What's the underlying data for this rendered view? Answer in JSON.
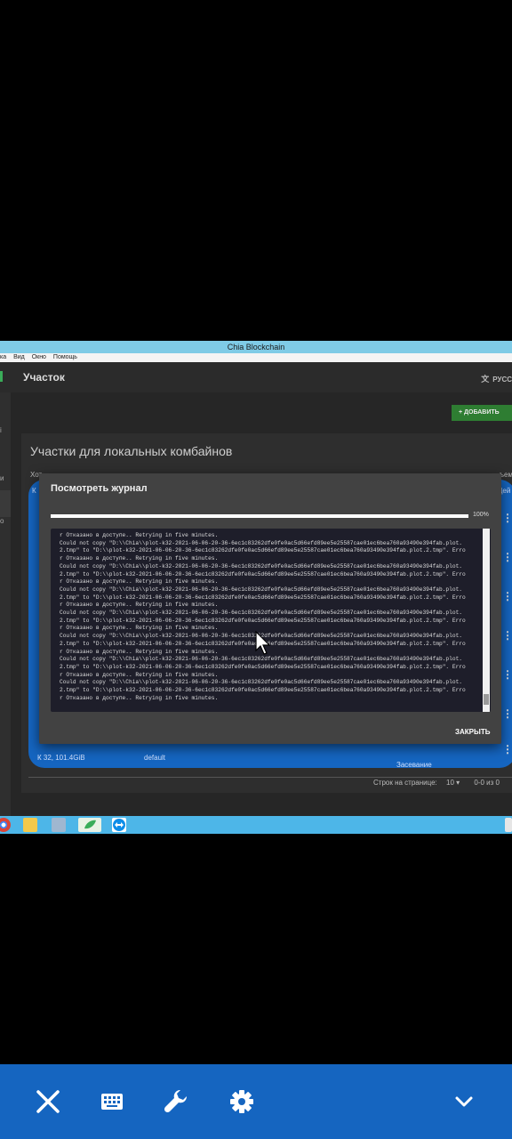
{
  "window": {
    "title": "Chia Blockchain"
  },
  "menu": [
    "ка",
    "Вид",
    "Окно",
    "Помощь"
  ],
  "app": {
    "header_title": "Участок",
    "language": "РУСС",
    "add_button": "+ ДОБАВИТЬ",
    "panel_title": "Участки для локальных комбайнов",
    "left_fragments": [
      "Хот",
      "К"
    ],
    "right_fragments": [
      "ъем",
      "Дей"
    ],
    "bottom_row": {
      "size": "К 32, 101.4GiB",
      "pool": "default",
      "status": "Засевание"
    },
    "pagination": {
      "rows_label": "Строк на странице:",
      "rows_value": "10",
      "range": "0-0 из 0"
    }
  },
  "dialog": {
    "title": "Посмотреть журнал",
    "progress_percent": 100,
    "progress_label": "100%",
    "log_lines": [
      "r Отказано в доступе.. Retrying in five minutes.",
      "Could not copy \"D:\\\\Chia\\\\plot-k32-2021-06-06-20-36-6ec1c83262dfe0fe0ac5d66efd89ee5e25587cae01ec6bea760a93490e394fab.plot.",
      "2.tmp\" to \"D:\\\\plot-k32-2021-06-06-20-36-6ec1c83262dfe0fe0ac5d66efd89ee5e25587cae01ec6bea760a93490e394fab.plot.2.tmp\". Erro",
      "r Отказано в доступе.. Retrying in five minutes.",
      "Could not copy \"D:\\\\Chia\\\\plot-k32-2021-06-06-20-36-6ec1c83262dfe0fe0ac5d66efd89ee5e25587cae01ec6bea760a93490e394fab.plot.",
      "2.tmp\" to \"D:\\\\plot-k32-2021-06-06-20-36-6ec1c83262dfe0fe0ac5d66efd89ee5e25587cae01ec6bea760a93490e394fab.plot.2.tmp\". Erro",
      "r Отказано в доступе.. Retrying in five minutes.",
      "Could not copy \"D:\\\\Chia\\\\plot-k32-2021-06-06-20-36-6ec1c83262dfe0fe0ac5d66efd89ee5e25587cae01ec6bea760a93490e394fab.plot.",
      "2.tmp\" to \"D:\\\\plot-k32-2021-06-06-20-36-6ec1c83262dfe0fe0ac5d66efd89ee5e25587cae01ec6bea760a93490e394fab.plot.2.tmp\". Erro",
      "r Отказано в доступе.. Retrying in five minutes.",
      "Could not copy \"D:\\\\Chia\\\\plot-k32-2021-06-06-20-36-6ec1c83262dfe0fe0ac5d66efd89ee5e25587cae01ec6bea760a93490e394fab.plot.",
      "2.tmp\" to \"D:\\\\plot-k32-2021-06-06-20-36-6ec1c83262dfe0fe0ac5d66efd89ee5e25587cae01ec6bea760a93490e394fab.plot.2.tmp\". Erro",
      "r Отказано в доступе.. Retrying in five minutes.",
      "Could not copy \"D:\\\\Chia\\\\plot-k32-2021-06-06-20-36-6ec1c83262dfe0fe0ac5d66efd89ee5e25587cae01ec6bea760a93490e394fab.plot.",
      "2.tmp\" to \"D:\\\\plot-k32-2021-06-06-20-36-6ec1c83262dfe0fe0ac5d66efd89ee5e25587cae01ec6bea760a93490e394fab.plot.2.tmp\". Erro",
      "r Отказано в доступе.. Retrying in five minutes.",
      "Could not copy \"D:\\\\Chia\\\\plot-k32-2021-06-06-20-36-6ec1c83262dfe0fe0ac5d66efd89ee5e25587cae01ec6bea760a93490e394fab.plot.",
      "2.tmp\" to \"D:\\\\plot-k32-2021-06-06-20-36-6ec1c83262dfe0fe0ac5d66efd89ee5e25587cae01ec6bea760a93490e394fab.plot.2.tmp\". Erro",
      "r Отказано в доступе.. Retrying in five minutes.",
      "Could not copy \"D:\\\\Chia\\\\plot-k32-2021-06-06-20-36-6ec1c83262dfe0fe0ac5d66efd89ee5e25587cae01ec6bea760a93490e394fab.plot.",
      "2.tmp\" to \"D:\\\\plot-k32-2021-06-06-20-36-6ec1c83262dfe0fe0ac5d66efd89ee5e25587cae01ec6bea760a93490e394fab.plot.2.tmp\". Erro",
      "r Отказано в доступе.. Retrying in five minutes."
    ],
    "close_label": "ЗАКРЫТЬ"
  },
  "taskbar": {
    "icons": [
      "chrome-icon",
      "folder-icon",
      "network-icon",
      "chia-icon",
      "teamviewer-icon"
    ]
  },
  "android_nav": {
    "buttons": [
      "close-icon",
      "keyboard-icon",
      "wrench-icon",
      "settings-icon",
      "chevron-down-icon"
    ]
  },
  "colors": {
    "accent_blue": "#1565c0",
    "taskbar": "#4db6e8",
    "titlebar": "#7fcbe6",
    "green_button": "#2e7d32"
  }
}
